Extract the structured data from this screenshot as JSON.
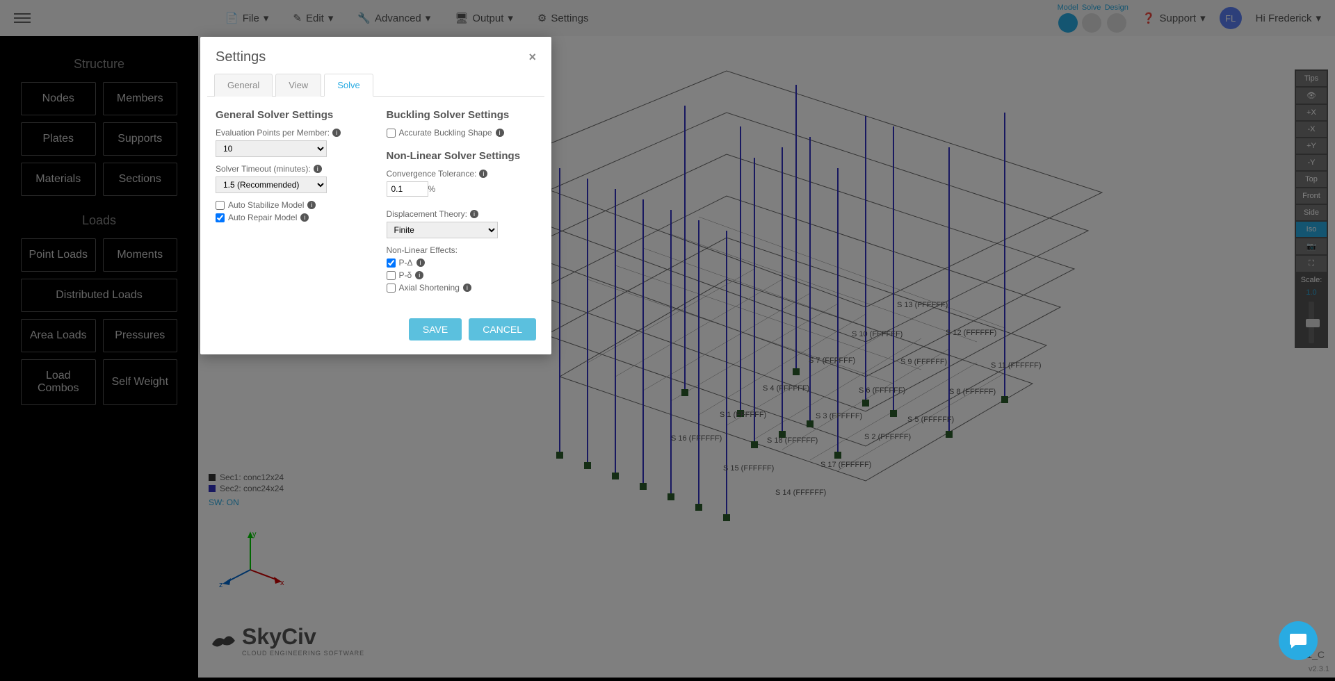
{
  "toolbar": {
    "menus": [
      "File",
      "Edit",
      "Advanced",
      "Output",
      "Settings"
    ],
    "modes": [
      "Model",
      "Solve",
      "Design"
    ],
    "support": "Support",
    "user_initials": "FL",
    "user_greeting": "Hi Frederick"
  },
  "sidebar": {
    "sections": [
      {
        "title": "Structure",
        "buttons": [
          "Nodes",
          "Members",
          "Plates",
          "Supports",
          "Materials",
          "Sections"
        ]
      },
      {
        "title": "Loads",
        "buttons": [
          "Point Loads",
          "Moments",
          "Distributed Loads",
          "Area Loads",
          "Pressures",
          "Load Combos",
          "Self Weight"
        ]
      }
    ]
  },
  "legend": {
    "items": [
      {
        "color": "#333",
        "label": "Sec1: conc12x24"
      },
      {
        "color": "#3030c0",
        "label": "Sec2: conc24x24"
      }
    ],
    "sw": "SW: ON"
  },
  "view_controls": {
    "buttons": [
      "Tips",
      "👁",
      "+X",
      "-X",
      "+Y",
      "-Y",
      "Top",
      "Front",
      "Side",
      "Iso",
      "📷",
      "⛶"
    ],
    "active": "Iso",
    "scale_label": "Scale:",
    "scale_value": "1.0"
  },
  "modal": {
    "title": "Settings",
    "tabs": [
      "General",
      "View",
      "Solve"
    ],
    "active_tab": "Solve",
    "general_solver": {
      "title": "General Solver Settings",
      "eval_label": "Evaluation Points per Member:",
      "eval_value": "10",
      "timeout_label": "Solver Timeout (minutes):",
      "timeout_value": "1.5 (Recommended)",
      "auto_stabilize": "Auto Stabilize Model",
      "auto_repair": "Auto Repair Model"
    },
    "buckling": {
      "title": "Buckling Solver Settings",
      "accurate": "Accurate Buckling Shape"
    },
    "nonlinear": {
      "title": "Non-Linear Solver Settings",
      "conv_label": "Convergence Tolerance:",
      "conv_value": "0.1",
      "disp_label": "Displacement Theory:",
      "disp_value": "Finite",
      "effects_label": "Non-Linear Effects:",
      "p_delta_big": "P-Δ",
      "p_delta_small": "P-δ",
      "axial": "Axial Shortening"
    },
    "save": "SAVE",
    "cancel": "CANCEL"
  },
  "support_labels": [
    "S 13 (FFFFFF)",
    "S 10 (FFFFFF)",
    "S 12 (FFFFFF)",
    "S 7 (FFFFFF)",
    "S 9 (FFFFFF)",
    "S 11 (FFFFFF)",
    "S 4 (FFFFFF)",
    "S 6 (FFFFFF)",
    "S 8 (FFFFFF)",
    "S 1 (FFFFFF)",
    "S 3 (FFFFFF)",
    "S 5 (FFFFFF)",
    "S 16 (FFFFFF)",
    "S 18 (FFFFFF)",
    "S 2 (FFFFFF)",
    "S 15 (FFFFFF)",
    "S 17 (FFFFFF)",
    "S 14 (FFFFFF)"
  ],
  "version": "v2.3.1",
  "bottom_label": "64D1_C",
  "logo": {
    "name": "SkyCiv",
    "sub": "CLOUD ENGINEERING SOFTWARE"
  }
}
